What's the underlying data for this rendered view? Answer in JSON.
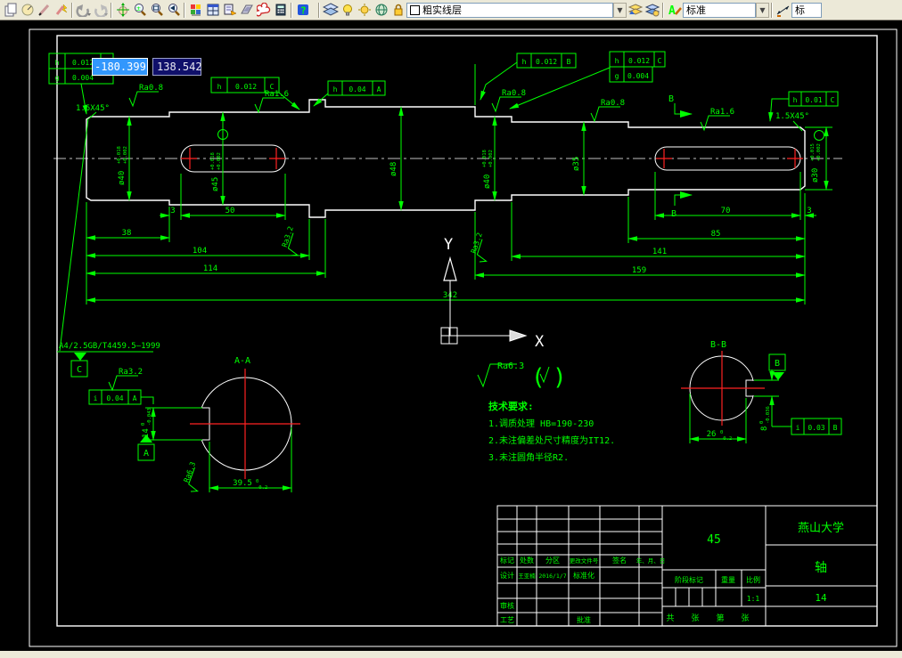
{
  "toolbar": {
    "layer_dropdown": "粗实线层",
    "style_dropdown": "标准",
    "dim_dropdown": "标",
    "icons": [
      "copy",
      "circle-tool",
      "pencil",
      "pencil-flash",
      "undo",
      "redo",
      "pan-hand",
      "zoom-realtime",
      "zoom-window",
      "zoom-previous",
      "palette",
      "grid-window",
      "layout-arrow",
      "sheet-3d",
      "revision-cloud",
      "calculator",
      "help",
      "layers-stack",
      "bulb",
      "sun",
      "globe",
      "lock",
      "layer-previous",
      "layer-states",
      "text-style",
      "dim-style"
    ]
  },
  "coord_inputs": {
    "x_value": "-180.399",
    "y_value": "138.542"
  },
  "main_view": {
    "chamfer_left": "1.5X45°",
    "chamfer_right": "1.5X45°",
    "roughness": {
      "s1": "Ra0.8",
      "s2": "Ra1.6",
      "s5": "Ra0.8",
      "s6": "Ra0.8",
      "s7": "Ra1.6",
      "fillet_left": "Ra3.2",
      "fillet_right": "Ra3.2"
    },
    "frames": {
      "f1": {
        "r1": [
          "h",
          "0.012",
          "B"
        ],
        "r2": [
          "g",
          "0.004"
        ]
      },
      "f2": [
        "h",
        "0.012",
        "C"
      ],
      "f3": [
        "h",
        "0.04",
        "A"
      ],
      "f4": [
        "h",
        "0.012",
        "B"
      ],
      "f5": {
        "r1": [
          "h",
          "0.012",
          "C"
        ],
        "r2": [
          "g",
          "0.004"
        ]
      },
      "f6": [
        "h",
        "0.01",
        "C"
      ]
    },
    "dims_linear": {
      "d3a": "3",
      "d50": "50",
      "d38": "38",
      "d104": "104",
      "d114": "114",
      "d342": "342",
      "d70": "70",
      "d3b": "3",
      "d85": "85",
      "d141": "141",
      "d159": "159"
    },
    "dims_dia": {
      "da": "ø40",
      "da_t1": "+0.018",
      "da_t2": "+0.002",
      "db": "ø45",
      "db_t1": "+0.018",
      "db_t2": "+0.002",
      "dc": "ø48",
      "dd": "ø40",
      "dd_t1": "+0.018",
      "dd_t2": "+0.002",
      "de": "ø35",
      "df": "ø30",
      "df_t1": "+0.015",
      "df_t2": "+0.002"
    },
    "section_marker": "B"
  },
  "section_a": {
    "label": "A-A",
    "datum_c": "C",
    "datum_a": "A",
    "frame": [
      "i",
      "0.04",
      "A"
    ],
    "roughness": "Ra3.2",
    "roughness2": "Ra6.3",
    "width_dim": "14",
    "width_tol_u": "0",
    "width_tol_l": "-0.043",
    "depth_dim": "39.5",
    "depth_tol_u": "0",
    "depth_tol_l": "-0.2",
    "note": "A4/2.5GB/T4459.5—1999"
  },
  "section_b": {
    "label": "B-B",
    "datum_b": "B",
    "frame": [
      "i",
      "0.03",
      "B"
    ],
    "width_dim": "8",
    "width_tol_u": "0",
    "width_tol_l": "-0.036",
    "depth_dim": "26",
    "depth_tol_u": "0",
    "depth_tol_l": "-0.2"
  },
  "notes": {
    "general_roughness": "Ra6.3",
    "paren_open": "(",
    "paren_close": ")",
    "title": "技术要求:",
    "lines": [
      "1.调质处理 HB=190-230",
      "2.未注偏差处尺寸精度为IT12.",
      "3.未注圆角半径R2."
    ]
  },
  "ucs": {
    "x": "X",
    "y": "Y"
  },
  "title_block": {
    "university": "燕山大学",
    "part_name": "轴",
    "drawing_no": "14",
    "material": "45",
    "scale_value": "1:1",
    "designer": "王亚楠",
    "date": "2016/1/7",
    "headers": {
      "biaoji": "标记",
      "chushu": "处数",
      "fenqu": "分区",
      "genggai": "更改文件号",
      "qianming": "签名",
      "riqi": "年、月、日",
      "sheji": "设计",
      "biaozhunhua": "标准化",
      "shenhe": "审核",
      "gongyi": "工艺",
      "pizhun": "批准",
      "jieduan": "阶段标记",
      "zhongliang": "重量",
      "bili": "比例",
      "gong": "共",
      "zhang1": "张",
      "di": "第",
      "zhang2": "张"
    }
  },
  "colors": {
    "annotation": "#00ff00",
    "outline": "#ffffff",
    "centermark": "#ff2222",
    "hatch": "#00dcdc",
    "selection": "#3297fd",
    "input_bg": "#10106a"
  }
}
